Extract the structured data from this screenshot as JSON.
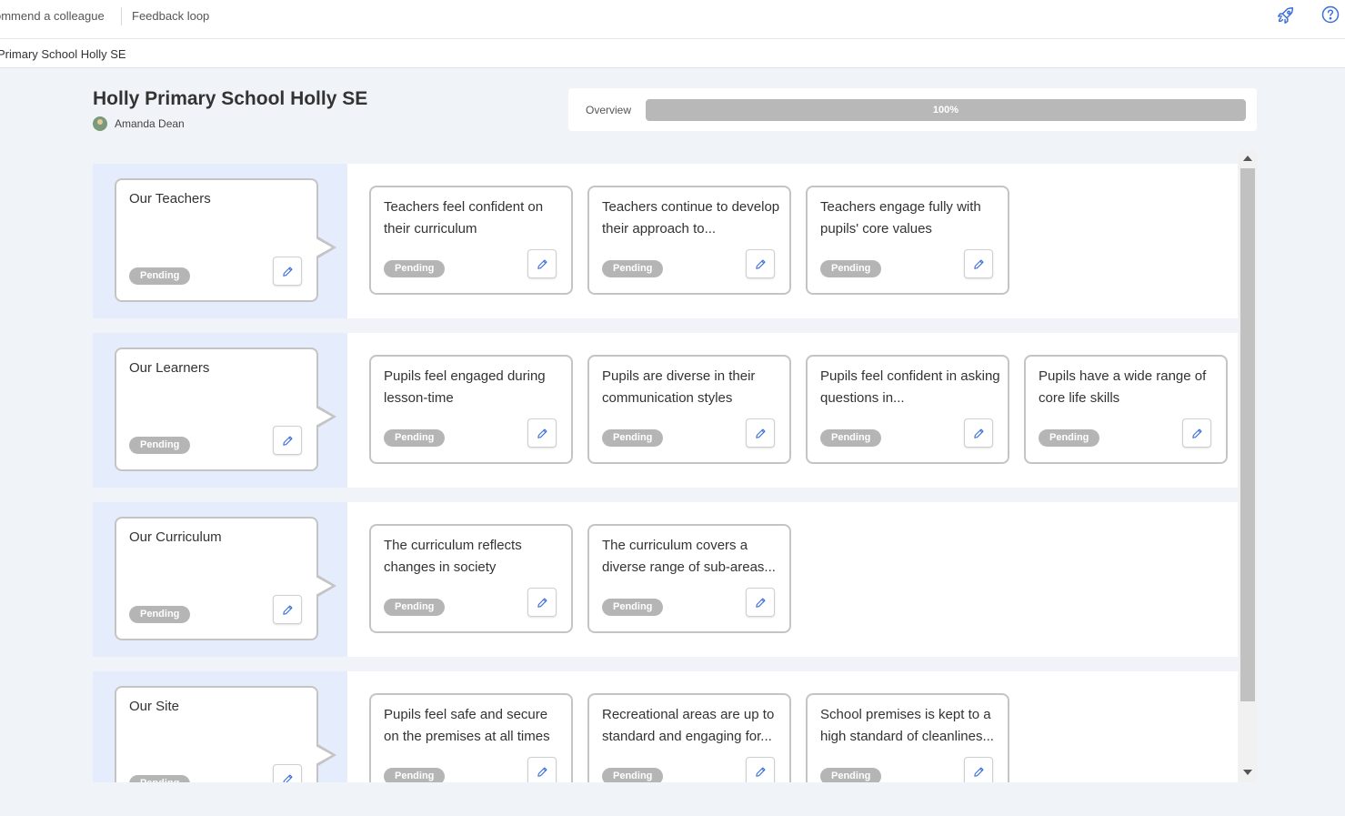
{
  "topnav": {
    "recommend_label": "ommend a colleague",
    "feedback_label": "Feedback loop"
  },
  "breadcrumb": "Primary School Holly SE",
  "header": {
    "title": "Holly Primary School Holly SE",
    "owner": "Amanda Dean"
  },
  "overview": {
    "label": "Overview",
    "progress_text": "100%",
    "progress_fraction": 1.0
  },
  "status_label": "Pending",
  "colors": {
    "pillar_panel": "#e5ecfb",
    "badge": "#b5b5b5",
    "edit_icon": "#3b6fd8",
    "rocket_icon": "#3b6fd8"
  },
  "pillars": [
    {
      "title": "Our Teachers",
      "status": "Pending",
      "cards": [
        {
          "text": "Teachers feel confident on their curriculum",
          "status": "Pending"
        },
        {
          "text": "Teachers continue to develop their approach to...",
          "status": "Pending"
        },
        {
          "text": "Teachers engage fully with pupils' core values",
          "status": "Pending"
        }
      ]
    },
    {
      "title": "Our Learners",
      "status": "Pending",
      "cards": [
        {
          "text": "Pupils feel engaged during lesson-time",
          "status": "Pending"
        },
        {
          "text": "Pupils are diverse in their communication styles",
          "status": "Pending"
        },
        {
          "text": "Pupils feel confident in asking questions in...",
          "status": "Pending"
        },
        {
          "text": "Pupils have a wide range of core life skills",
          "status": "Pending"
        }
      ]
    },
    {
      "title": "Our Curriculum",
      "status": "Pending",
      "cards": [
        {
          "text": "The curriculum reflects changes in society",
          "status": "Pending"
        },
        {
          "text": "The curriculum covers a diverse range of sub-areas...",
          "status": "Pending"
        }
      ]
    },
    {
      "title": "Our Site",
      "status": "Pending",
      "cards": [
        {
          "text": "Pupils feel safe and secure on the premises at all times",
          "status": "Pending"
        },
        {
          "text": "Recreational areas are up to standard and engaging for...",
          "status": "Pending"
        },
        {
          "text": "School premises is kept to a high standard of cleanlines...",
          "status": "Pending"
        }
      ]
    }
  ]
}
